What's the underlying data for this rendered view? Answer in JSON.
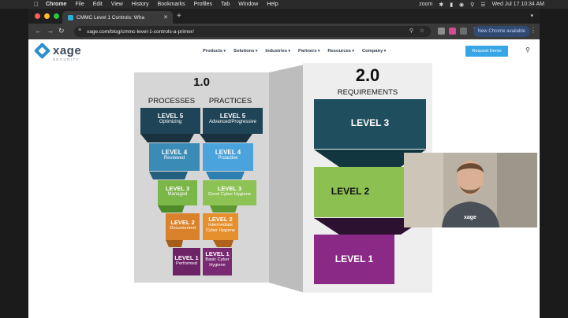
{
  "menubar": {
    "app": "Chrome",
    "items": [
      "File",
      "Edit",
      "View",
      "History",
      "Bookmarks",
      "Profiles",
      "Tab",
      "Window",
      "Help"
    ],
    "zoom": "zoom",
    "datetime": "Wed Jul 17  10:34 AM"
  },
  "browser": {
    "tab_title": "CMMC Level 1 Controls: Wha",
    "url": "xage.com/blog/cmmc-level-1-controls-a-primer/",
    "update_button": "New Chrome available"
  },
  "site": {
    "logo": "xage",
    "logo_sub": "SECURITY",
    "nav": [
      "Products",
      "Solutions",
      "Industries",
      "Partners",
      "Resources",
      "Company"
    ],
    "cta": "Request Demo"
  },
  "diagram": {
    "left_heading": "1.0",
    "col1_heading": "PROCESSES",
    "col2_heading": "PRACTICES",
    "right_heading": "2.0",
    "right_subheading": "REQUIREMENTS",
    "processes": [
      {
        "level": "LEVEL 5",
        "label": "Optimizing",
        "color": "#1f4457"
      },
      {
        "level": "LEVEL 4",
        "label": "Reviewed",
        "color": "#3a8bb5"
      },
      {
        "level": "LEVEL 3",
        "label": "Managed",
        "color": "#7ab648"
      },
      {
        "level": "LEVEL 2",
        "label": "Documented",
        "color": "#d9822b"
      },
      {
        "level": "LEVEL 1",
        "label": "Performed",
        "color": "#6d2466"
      }
    ],
    "practices": [
      {
        "level": "LEVEL 5",
        "label": "Advanced/Progressive",
        "color": "#1f4457"
      },
      {
        "level": "LEVEL 4",
        "label": "Proactive",
        "color": "#4aa3dc"
      },
      {
        "level": "LEVEL 3",
        "label": "Good Cyber Hygiene",
        "color": "#8dc355"
      },
      {
        "level": "LEVEL 2",
        "label": "Intermediate Cyber Hygiene",
        "color": "#e58f2d"
      },
      {
        "level": "LEVEL 1",
        "label": "Basic Cyber Hygiene",
        "color": "#7a2a72"
      }
    ],
    "requirements": [
      {
        "level": "LEVEL 3",
        "color": "#1f4e5f"
      },
      {
        "level": "LEVEL 2",
        "color": "#8cc152"
      },
      {
        "level": "LEVEL 1",
        "color": "#8a2a86"
      }
    ]
  },
  "video": {
    "shirt_logo": "xage"
  }
}
